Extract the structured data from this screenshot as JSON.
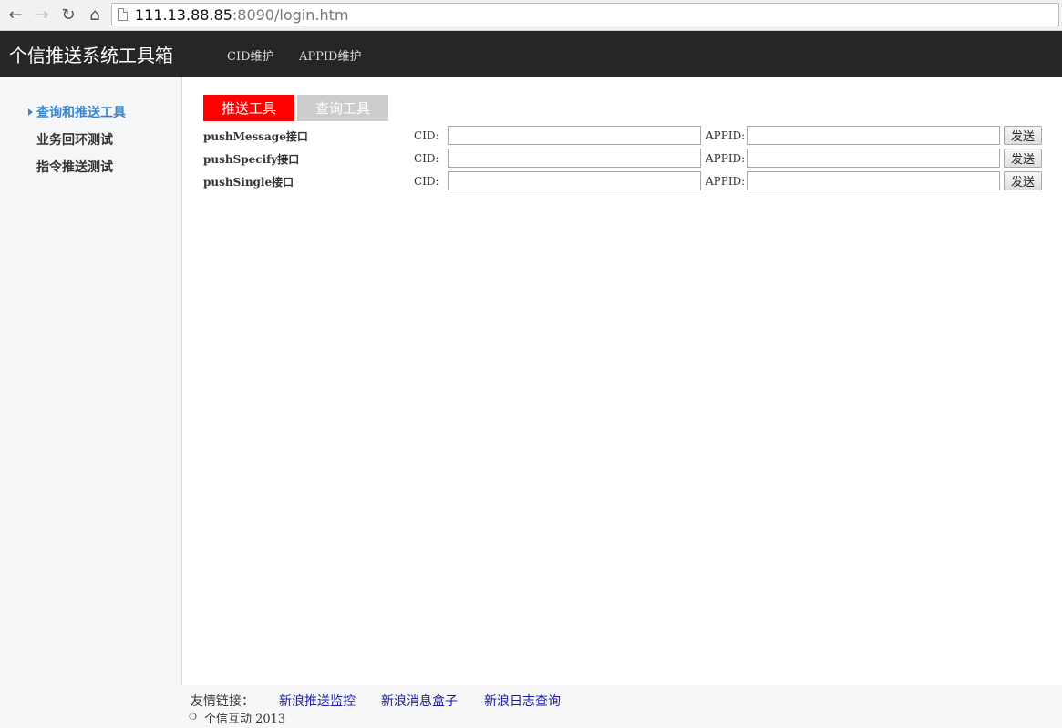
{
  "browser": {
    "url_host": "111.13.88.85",
    "url_rest": ":8090/login.htm",
    "back_icon": "back-arrow-icon",
    "forward_icon": "forward-arrow-icon",
    "reload_icon": "reload-icon",
    "home_icon": "home-icon"
  },
  "header": {
    "brand": "个信推送系统工具箱",
    "nav": [
      "CID维护",
      "APPID维护"
    ]
  },
  "sidebar": {
    "items": [
      {
        "label": "查询和推送工具",
        "active": true
      },
      {
        "label": "业务回环测试",
        "active": false
      },
      {
        "label": "指令推送测试",
        "active": false
      }
    ]
  },
  "tabs": {
    "push": "推送工具",
    "query": "查询工具",
    "active_color": "#ff0000",
    "inactive_color": "#cccccc"
  },
  "rows": [
    {
      "label": "pushMessage接口",
      "cid_label": "CID:",
      "cid_value": "",
      "appid_label": "APPID:",
      "appid_value": "",
      "button": "发送"
    },
    {
      "label": "pushSpecify接口",
      "cid_label": "CID:",
      "cid_value": "",
      "appid_label": "APPID:",
      "appid_value": "",
      "button": "发送"
    },
    {
      "label": "pushSingle接口",
      "cid_label": "CID:",
      "cid_value": "",
      "appid_label": "APPID:",
      "appid_value": "",
      "button": "发送"
    }
  ],
  "footer": {
    "links_label": "友情链接：",
    "links": [
      "新浪推送监控",
      "新浪消息盒子",
      "新浪日志查询"
    ],
    "copyright": "个信互动 2013"
  }
}
